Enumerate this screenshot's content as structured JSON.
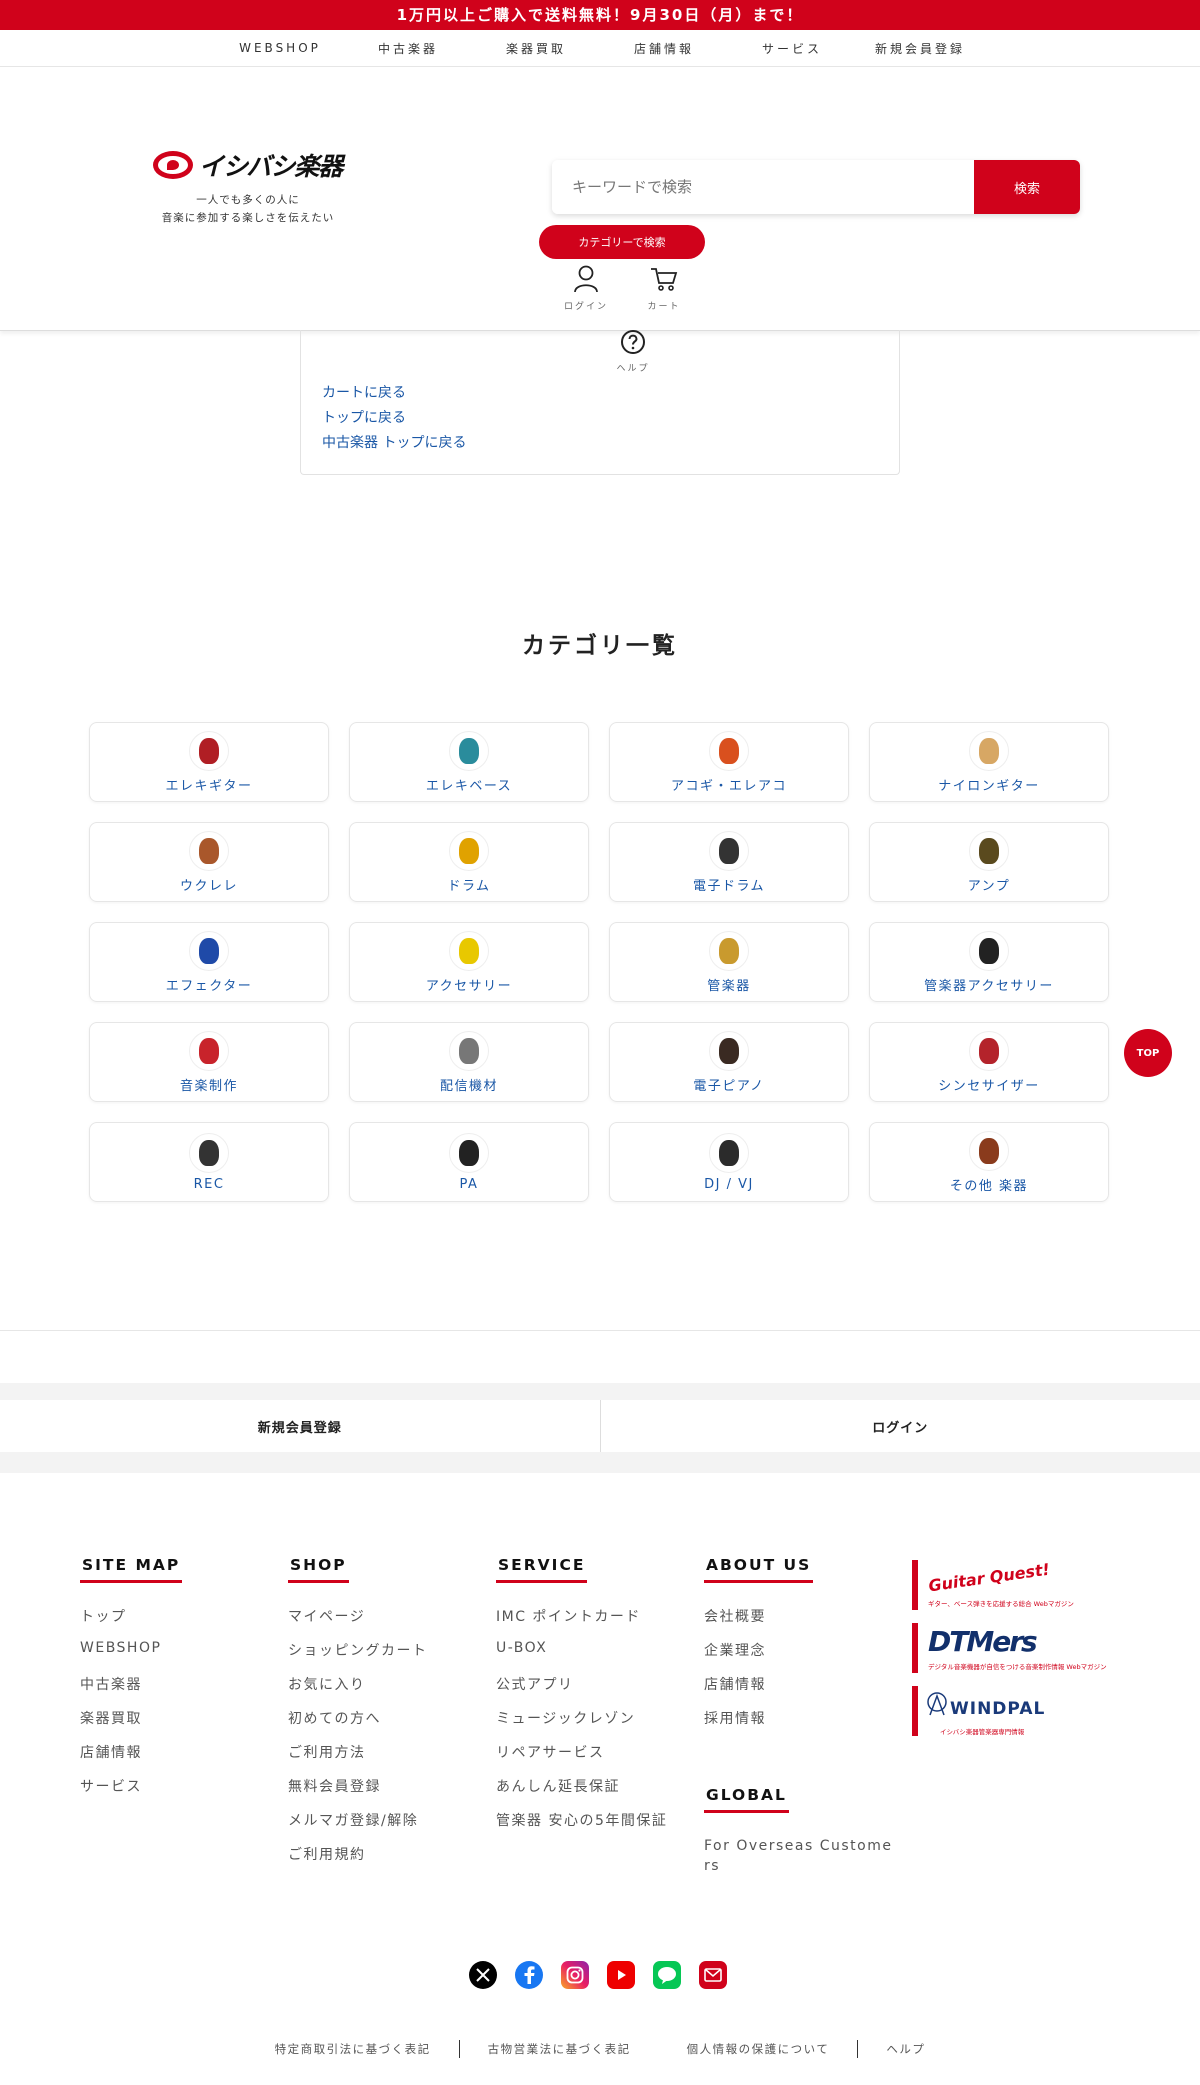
{
  "promo": "1万円以上ご購入で送料無料！9月30日（月）まで！",
  "topnav": [
    "WEBSHOP",
    "中古楽器",
    "楽器買取",
    "店舗情報",
    "サービス",
    "新規会員登録"
  ],
  "logo": {
    "text": "イシバシ楽器",
    "tagline_1": "一人でも多くの人に",
    "tagline_2": "音楽に参加する楽しさを伝えたい"
  },
  "search": {
    "placeholder": "キーワードで検索",
    "button": "検索",
    "category_button": "カテゴリーで検索"
  },
  "header_icons": {
    "login": "ログイン",
    "cart": "カート",
    "help": "ヘルプ"
  },
  "card_links": [
    "カートに戻る",
    "トップに戻る",
    "中古楽器 トップに戻る"
  ],
  "categories": {
    "title": "カテゴリ一覧",
    "items": [
      {
        "label": "エレキギター",
        "icon": "electric-guitar-icon",
        "color": "#b01e24"
      },
      {
        "label": "エレキベース",
        "icon": "electric-bass-icon",
        "color": "#2a8c9c"
      },
      {
        "label": "アコギ・エレアコ",
        "icon": "acoustic-guitar-icon",
        "color": "#d9501e"
      },
      {
        "label": "ナイロンギター",
        "icon": "nylon-guitar-icon",
        "color": "#d7a764"
      },
      {
        "label": "ウクレレ",
        "icon": "ukulele-icon",
        "color": "#a9572b"
      },
      {
        "label": "ドラム",
        "icon": "drum-icon",
        "color": "#e0a200"
      },
      {
        "label": "電子ドラム",
        "icon": "electronic-drum-icon",
        "color": "#333333"
      },
      {
        "label": "アンプ",
        "icon": "amp-icon",
        "color": "#5a4a1e"
      },
      {
        "label": "エフェクター",
        "icon": "effector-icon",
        "color": "#1f4aa8"
      },
      {
        "label": "アクセサリー",
        "icon": "accessory-icon",
        "color": "#e8c800"
      },
      {
        "label": "管楽器",
        "icon": "saxophone-icon",
        "color": "#c99a2e"
      },
      {
        "label": "管楽器アクセサリー",
        "icon": "mouthpiece-icon",
        "color": "#222222"
      },
      {
        "label": "音楽制作",
        "icon": "audio-interface-icon",
        "color": "#c8232b"
      },
      {
        "label": "配信機材",
        "icon": "mixer-icon",
        "color": "#777777"
      },
      {
        "label": "電子ピアノ",
        "icon": "digital-piano-icon",
        "color": "#3a2a22"
      },
      {
        "label": "シンセサイザー",
        "icon": "synthesizer-icon",
        "color": "#b4232b"
      },
      {
        "label": "REC",
        "icon": "recorder-icon",
        "color": "#333333"
      },
      {
        "label": "PA",
        "icon": "speaker-icon",
        "color": "#222222"
      },
      {
        "label": "DJ / VJ",
        "icon": "dj-controller-icon",
        "color": "#2b2b2b"
      },
      {
        "label": "その他 楽器",
        "icon": "violin-icon",
        "color": "#8a3b1c"
      }
    ]
  },
  "top_button": "TOP",
  "member": {
    "register": "新規会員登録",
    "login": "ログイン"
  },
  "footer": {
    "sitemap": {
      "title": "SITE MAP",
      "items": [
        "トップ",
        "WEBSHOP",
        "中古楽器",
        "楽器買取",
        "店舗情報",
        "サービス"
      ]
    },
    "shop": {
      "title": "SHOP",
      "items": [
        "マイページ",
        "ショッピングカート",
        "お気に入り",
        "初めての方へ",
        "ご利用方法",
        "無料会員登録",
        "メルマガ登録/解除",
        "ご利用規約"
      ]
    },
    "service": {
      "title": "SERVICE",
      "items": [
        "IMC ポイントカード",
        "U-BOX",
        "公式アプリ",
        "ミュージックレゾン",
        "リペアサービス",
        "あんしん延長保証",
        "管楽器 安心の5年間保証"
      ]
    },
    "about": {
      "title": "ABOUT US",
      "items": [
        "会社概要",
        "企業理念",
        "店舗情報",
        "採用情報"
      ]
    },
    "global": {
      "title": "GLOBAL",
      "link": "For Overseas Customers"
    },
    "media": [
      {
        "name": "Guitar Quest!",
        "sub": "ギター、ベース弾きを応援する総合 Webマガジン"
      },
      {
        "name": "DTMers",
        "sub": "デジタル音楽機器が自信をつける音楽制作情報 Webマガジン"
      },
      {
        "name": "WINDPAL",
        "sub": "イシバシ楽器管楽器専門情報"
      }
    ]
  },
  "social": [
    "x-icon",
    "facebook-icon",
    "instagram-icon",
    "youtube-icon",
    "line-icon",
    "mail-icon"
  ],
  "legal": [
    "特定商取引法に基づく表記",
    "古物営業法に基づく表記",
    "個人情報の保護について",
    "ヘルプ"
  ]
}
